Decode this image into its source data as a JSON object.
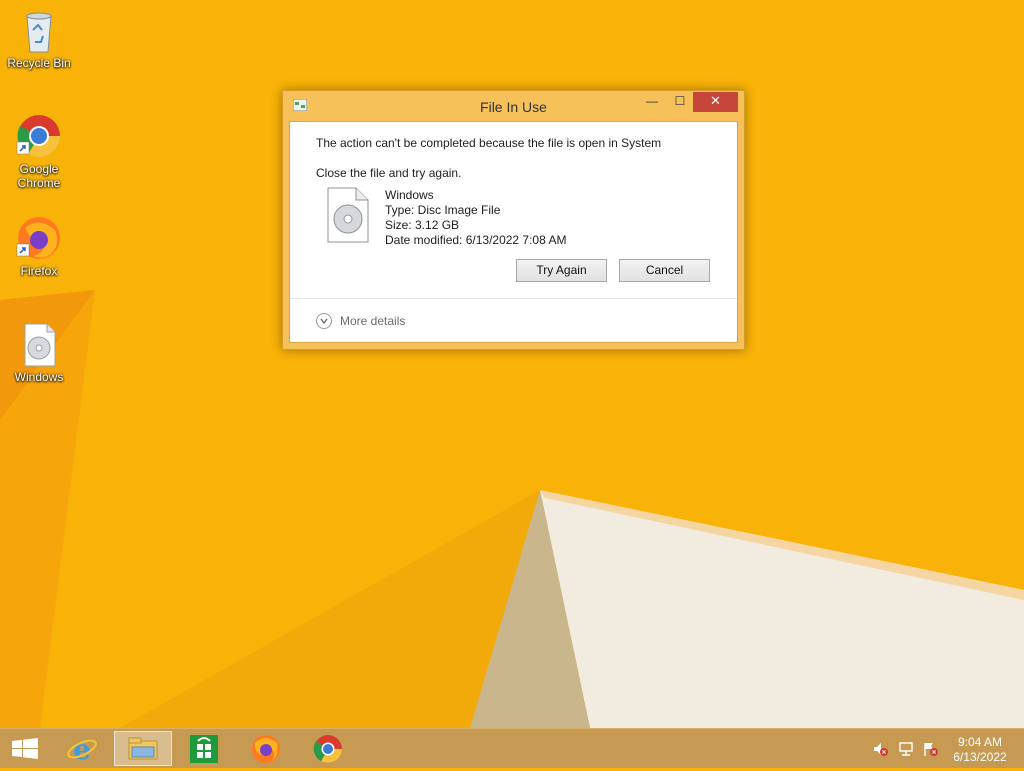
{
  "desktop": {
    "icons": [
      {
        "label": "Recycle Bin"
      },
      {
        "label": "Google\nChrome"
      },
      {
        "label": "Firefox"
      },
      {
        "label": "Windows"
      }
    ]
  },
  "dialog": {
    "title": "File In Use",
    "close_glyph": "✕",
    "min_glyph": "—",
    "max_glyph": "☐",
    "message": "The action can't be completed because the file is open in System",
    "instruction": "Close the file and try again.",
    "file": {
      "name": "Windows",
      "type": "Type: Disc Image File",
      "size": "Size: 3.12 GB",
      "date_modified": "Date modified: 6/13/2022 7:08 AM"
    },
    "buttons": {
      "try_again": "Try Again",
      "cancel": "Cancel"
    },
    "more_details": "More details"
  },
  "taskbar": {
    "items": [
      "start-icon",
      "internet-explorer-icon",
      "file-explorer-icon",
      "store-icon",
      "firefox-icon",
      "chrome-icon"
    ],
    "clock": {
      "time": "9:04 AM",
      "date": "6/13/2022"
    }
  },
  "colors": {
    "wallpaper": "#f8b208",
    "dialog_frame": "#f5c158",
    "close_button": "#c7463a",
    "taskbar": "#c79a54"
  }
}
